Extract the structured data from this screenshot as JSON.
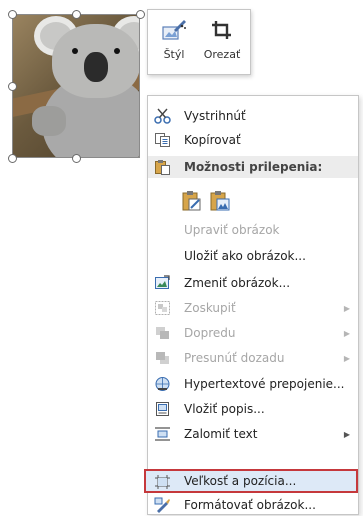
{
  "mini_toolbar": {
    "style_label": "Štýl",
    "crop_label": "Orezať"
  },
  "context_menu": {
    "items": [
      {
        "label": "Vystrihnúť",
        "icon": "scissors-icon",
        "disabled": false
      },
      {
        "label": "Kopírovať",
        "icon": "copy-icon",
        "disabled": false
      },
      {
        "label": "Možnosti prilepenia:",
        "icon": "clipboard-icon",
        "header": true
      },
      {
        "label": "Upraviť obrázok",
        "disabled": true
      },
      {
        "label": "Uložiť ako obrázok...",
        "disabled": false
      },
      {
        "label": "Zmeniť obrázok...",
        "icon": "change-picture-icon",
        "disabled": false
      },
      {
        "label": "Zoskupiť",
        "icon": "group-icon",
        "disabled": true,
        "submenu": true
      },
      {
        "label": "Dopredu",
        "icon": "bring-forward-icon",
        "disabled": true,
        "submenu": true
      },
      {
        "label": "Presunúť dozadu",
        "icon": "send-backward-icon",
        "disabled": true,
        "submenu": true
      },
      {
        "label": "Hypertextové prepojenie...",
        "icon": "hyperlink-icon",
        "disabled": false
      },
      {
        "label": "Vložiť popis...",
        "icon": "caption-icon",
        "disabled": false
      },
      {
        "label": "Zalomiť text",
        "icon": "wrap-text-icon",
        "disabled": false,
        "submenu": true
      },
      {
        "label": "Veľkosť a pozícia...",
        "icon": "size-position-icon",
        "disabled": false,
        "highlighted": true
      },
      {
        "label": "Formátovať obrázok...",
        "icon": "format-picture-icon",
        "disabled": false
      }
    ],
    "paste_options": [
      "paste-keep-icon",
      "paste-picture-icon"
    ]
  },
  "colors": {
    "highlight_border": "#c5383c",
    "highlight_fill": "#dde9f7",
    "disabled_text": "#a6a6a6"
  }
}
